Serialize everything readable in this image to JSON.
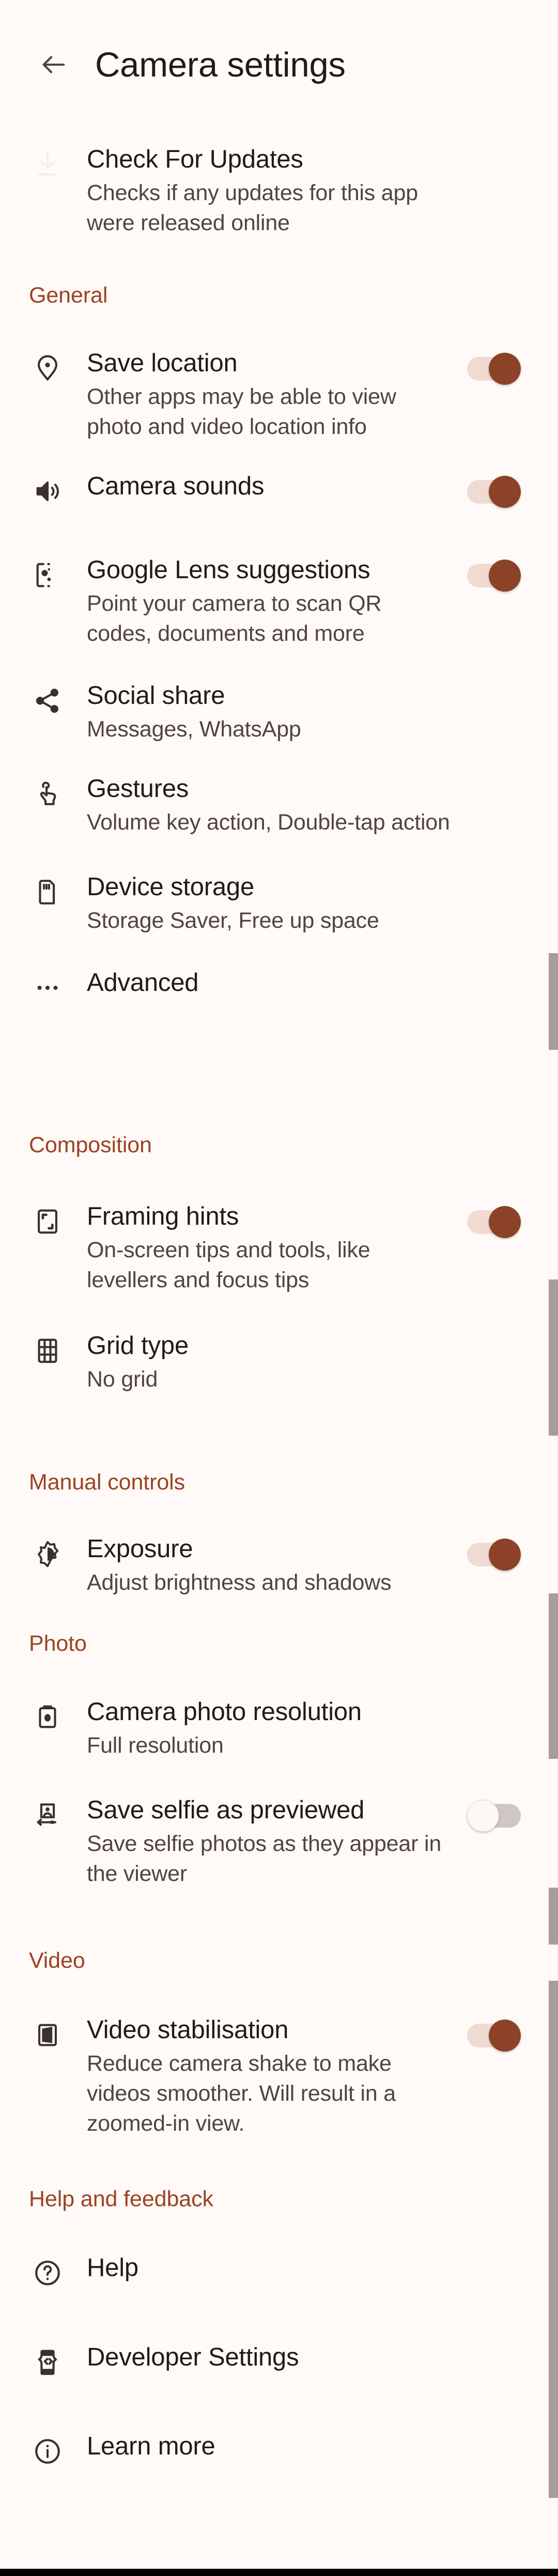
{
  "app": {
    "title": "Camera settings",
    "back_icon": "arrow-back-icon",
    "background_color": "#FFFAF8",
    "accent_color": "#9C4322",
    "toggle_on_color": "#8B4226",
    "toggle_on_track_color": "#F0DBD3",
    "toggle_off_color": "#FBF7F5",
    "toggle_off_track_color": "#CFC7C2",
    "title_text_color": "#1F1B18",
    "subtitle_text_color": "#52443D"
  },
  "top_item": {
    "icon": "download-icon",
    "title": "Check For Updates",
    "subtitle": "Checks if any updates for this app were released online"
  },
  "sections": [
    {
      "header": "General",
      "items": [
        {
          "icon": "location-pin-icon",
          "title": "Save location",
          "subtitle": "Other apps may be able to view photo and video location info",
          "toggle": "on"
        },
        {
          "icon": "volume-up-icon",
          "title": "Camera sounds",
          "subtitle": "",
          "toggle": "on"
        },
        {
          "icon": "google-lens-icon",
          "title": "Google Lens suggestions",
          "subtitle": "Point your camera to scan QR codes, documents and more",
          "toggle": "on"
        },
        {
          "icon": "share-icon",
          "title": "Social share",
          "subtitle": "Messages, WhatsApp",
          "toggle": "none"
        },
        {
          "icon": "gesture-tap-icon",
          "title": "Gestures",
          "subtitle": "Volume key action, Double-tap action",
          "toggle": "none"
        },
        {
          "icon": "sd-card-icon",
          "title": "Device storage",
          "subtitle": "Storage Saver, Free up space",
          "toggle": "none"
        },
        {
          "icon": "more-horizontal-icon",
          "title": "Advanced",
          "subtitle": "",
          "toggle": "none"
        }
      ]
    },
    {
      "header": "Composition",
      "items": [
        {
          "icon": "framing-hints-icon",
          "title": "Framing hints",
          "subtitle": "On-screen tips and tools, like levellers and focus tips",
          "toggle": "on"
        },
        {
          "icon": "grid-icon",
          "title": "Grid type",
          "subtitle": "No grid",
          "toggle": "none"
        }
      ]
    },
    {
      "header": "Manual controls",
      "items": [
        {
          "icon": "exposure-icon",
          "title": "Exposure",
          "subtitle": "Adjust brightness and shadows",
          "toggle": "on"
        }
      ]
    },
    {
      "header": "Photo",
      "items": [
        {
          "icon": "camera-photo-icon",
          "title": "Camera photo resolution",
          "subtitle": "Full resolution",
          "toggle": "none"
        },
        {
          "icon": "selfie-flip-icon",
          "title": "Save selfie as previewed",
          "subtitle": "Save selfie photos as they appear in the viewer",
          "toggle": "off"
        }
      ]
    },
    {
      "header": "Video",
      "items": [
        {
          "icon": "video-stabilisation-icon",
          "title": "Video stabilisation",
          "subtitle": "Reduce camera shake to make videos smoother. Will result in a zoomed-in view.",
          "toggle": "on"
        }
      ]
    },
    {
      "header": "Help and feedback",
      "items": [
        {
          "icon": "help-circle-icon",
          "title": "Help",
          "subtitle": "",
          "toggle": "none"
        },
        {
          "icon": "developer-code-icon",
          "title": "Developer Settings",
          "subtitle": "",
          "toggle": "none"
        },
        {
          "icon": "info-circle-icon",
          "title": "Learn more",
          "subtitle": "",
          "toggle": "none"
        }
      ]
    }
  ]
}
